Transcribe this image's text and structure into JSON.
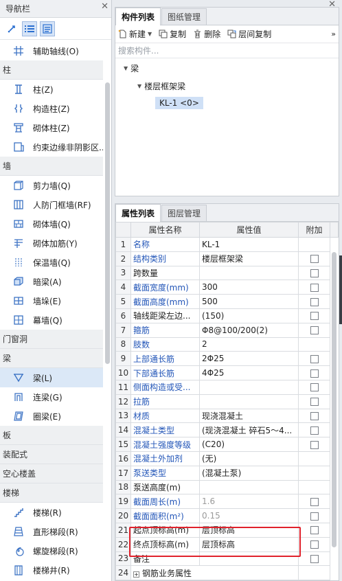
{
  "nav": {
    "title": "导航栏",
    "categories": [
      {
        "label": "柱",
        "items": []
      }
    ],
    "top_item": {
      "label": "辅助轴线(O)",
      "icon": "grid-axis-icon"
    },
    "groups": [
      {
        "label": "柱",
        "items": [
          {
            "label": "柱(Z)",
            "icon": "column-icon"
          },
          {
            "label": "构造柱(Z)",
            "icon": "constructional-column-icon"
          },
          {
            "label": "砌体柱(Z)",
            "icon": "masonry-column-icon"
          },
          {
            "label": "约束边缘非阴影区...",
            "icon": "constraint-edge-icon"
          }
        ]
      },
      {
        "label": "墙",
        "items": [
          {
            "label": "剪力墙(Q)",
            "icon": "shear-wall-icon"
          },
          {
            "label": "人防门框墙(RF)",
            "icon": "civil-defense-wall-icon"
          },
          {
            "label": "砌体墙(Q)",
            "icon": "masonry-wall-icon"
          },
          {
            "label": "砌体加筋(Y)",
            "icon": "masonry-rebar-icon"
          },
          {
            "label": "保温墙(Q)",
            "icon": "insulation-wall-icon"
          },
          {
            "label": "暗梁(A)",
            "icon": "hidden-beam-icon"
          },
          {
            "label": "墙垛(E)",
            "icon": "wall-pier-icon"
          },
          {
            "label": "幕墙(Q)",
            "icon": "curtain-wall-icon"
          }
        ]
      },
      {
        "label": "门窗洞",
        "items": []
      },
      {
        "label": "梁",
        "items": [
          {
            "label": "梁(L)",
            "icon": "beam-icon",
            "selected": true
          },
          {
            "label": "连梁(G)",
            "icon": "coupling-beam-icon"
          },
          {
            "label": "圈梁(E)",
            "icon": "ring-beam-icon"
          }
        ]
      },
      {
        "label": "板",
        "items": []
      },
      {
        "label": "装配式",
        "items": []
      },
      {
        "label": "空心楼盖",
        "items": []
      },
      {
        "label": "楼梯",
        "items": [
          {
            "label": "楼梯(R)",
            "icon": "stair-icon"
          },
          {
            "label": "直形梯段(R)",
            "icon": "straight-flight-icon"
          },
          {
            "label": "螺旋梯段(R)",
            "icon": "spiral-flight-icon"
          },
          {
            "label": "楼梯井(R)",
            "icon": "stairwell-icon"
          }
        ]
      }
    ]
  },
  "components": {
    "tabs": [
      "构件列表",
      "图纸管理"
    ],
    "toolbar": {
      "new": "新建",
      "copy": "复制",
      "delete": "删除",
      "floor_copy": "层间复制"
    },
    "search_placeholder": "搜索构件...",
    "tree": {
      "root": "梁",
      "child": "楼层框架梁",
      "leaf": "KL-1 <0>"
    }
  },
  "properties": {
    "tabs": [
      "属性列表",
      "图层管理"
    ],
    "headers": {
      "num": "",
      "name": "属性名称",
      "value": "属性值",
      "extra": "附加"
    },
    "rows": [
      {
        "n": "1",
        "name": "名称",
        "value": "KL-1",
        "blue": true,
        "check": false
      },
      {
        "n": "2",
        "name": "结构类别",
        "value": "楼层框架梁",
        "blue": true,
        "check": true
      },
      {
        "n": "3",
        "name": "跨数量",
        "value": "",
        "blue": false,
        "check": true
      },
      {
        "n": "4",
        "name": "截面宽度(mm)",
        "value": "300",
        "blue": true,
        "check": true
      },
      {
        "n": "5",
        "name": "截面高度(mm)",
        "value": "500",
        "blue": true,
        "check": true
      },
      {
        "n": "6",
        "name": "轴线距梁左边...",
        "value": "(150)",
        "blue": false,
        "check": true
      },
      {
        "n": "7",
        "name": "箍筋",
        "value": "Φ8@100/200(2)",
        "blue": true,
        "check": true
      },
      {
        "n": "8",
        "name": "肢数",
        "value": "2",
        "blue": true,
        "check": false
      },
      {
        "n": "9",
        "name": "上部通长筋",
        "value": "2Φ25",
        "blue": true,
        "check": true
      },
      {
        "n": "10",
        "name": "下部通长筋",
        "value": "4Φ25",
        "blue": true,
        "check": true
      },
      {
        "n": "11",
        "name": "侧面构造或受...",
        "value": "",
        "blue": true,
        "check": true
      },
      {
        "n": "12",
        "name": "拉筋",
        "value": "",
        "blue": true,
        "check": true
      },
      {
        "n": "13",
        "name": "材质",
        "value": "现浇混凝土",
        "blue": true,
        "check": true
      },
      {
        "n": "14",
        "name": "混凝土类型",
        "value": "(现浇混凝土    碎石5～4...",
        "blue": true,
        "check": true
      },
      {
        "n": "15",
        "name": "混凝土强度等级",
        "value": "(C20)",
        "blue": true,
        "check": true
      },
      {
        "n": "16",
        "name": "混凝土外加剂",
        "value": "(无)",
        "blue": true,
        "check": false
      },
      {
        "n": "17",
        "name": "泵送类型",
        "value": "(混凝土泵)",
        "blue": true,
        "check": false
      },
      {
        "n": "18",
        "name": "泵送高度(m)",
        "value": "",
        "blue": false,
        "check": false
      },
      {
        "n": "19",
        "name": "截面周长(m)",
        "value": "1.6",
        "blue": true,
        "gray": true,
        "check": true
      },
      {
        "n": "20",
        "name": "截面面积(m²)",
        "value": "0.15",
        "blue": true,
        "gray": true,
        "check": true
      },
      {
        "n": "21",
        "name": "起点顶标高(m)",
        "value": "层顶标高",
        "blue": false,
        "check": true
      },
      {
        "n": "22",
        "name": "终点顶标高(m)",
        "value": "层顶标高",
        "blue": false,
        "check": true
      },
      {
        "n": "23",
        "name": "备注",
        "value": "",
        "blue": false,
        "check": true
      },
      {
        "n": "24",
        "name": "钢筋业务属性",
        "value": "",
        "blue": false,
        "check": false,
        "expand": true
      }
    ]
  },
  "colors": {
    "blue_text": "#2356b8",
    "highlight": "#e0212b",
    "selected_bg": "#dbe8f7"
  }
}
